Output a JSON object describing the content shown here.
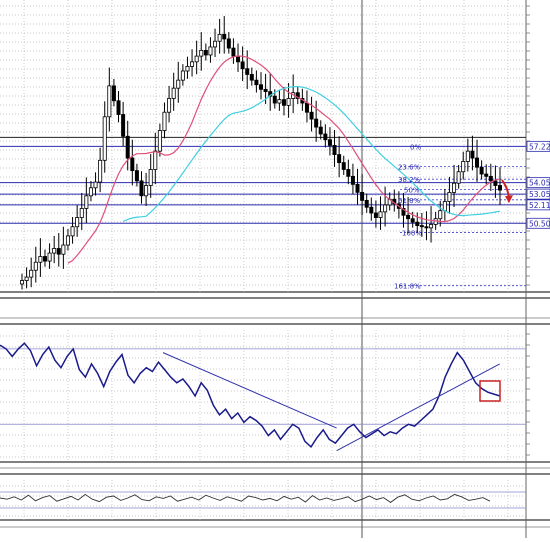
{
  "chart_data": [
    {
      "panel": "price",
      "type": "candlestick",
      "fib_labels": [
        "0%",
        "23.6%",
        "38.2%",
        "50%",
        "61.8%",
        "100%",
        "161.8%"
      ],
      "price_levels": [
        "57.22",
        "54.05",
        "53.05",
        "52.11",
        "50.50"
      ],
      "fib_levels": [
        {
          "label": "0%",
          "y": 57.22
        },
        {
          "label": "23.6%",
          "y": 55.45
        },
        {
          "label": "38.2%",
          "y": 54.35
        },
        {
          "label": "50%",
          "y": 53.45
        },
        {
          "label": "61.8%",
          "y": 52.55
        },
        {
          "label": "100%",
          "y": 49.7
        },
        {
          "label": "161.8%",
          "y": 45.05
        }
      ],
      "horizontal_lines": [
        58.0,
        57.22,
        54.05,
        53.05,
        52.11,
        50.5
      ],
      "price_close": [
        45.5,
        45.8,
        46.4,
        47.1,
        47.6,
        47.2,
        47.9,
        48.3,
        47.8,
        48.6,
        49.4,
        50.2,
        51.0,
        51.8,
        52.9,
        53.6,
        54.1,
        56.0,
        59.8,
        62.5,
        61.2,
        60.0,
        58.1,
        56.2,
        55.1,
        54.2,
        52.9,
        53.8,
        55.2,
        56.8,
        58.6,
        60.2,
        61.4,
        62.3,
        63.0,
        63.8,
        64.2,
        64.6,
        65.1,
        65.6,
        65.2,
        65.9,
        66.4,
        67.0,
        66.6,
        65.8,
        65.1,
        64.6,
        64.0,
        63.5,
        63.0,
        62.6,
        62.2,
        62.0,
        61.6,
        61.0,
        61.3,
        60.8,
        61.4,
        61.9,
        61.4,
        61.0,
        60.2,
        59.6,
        58.9,
        58.3,
        57.8,
        57.3,
        56.5,
        55.8,
        55.2,
        54.6,
        53.9,
        53.2,
        52.5,
        51.9,
        51.4,
        51.0,
        51.5,
        52.1,
        52.6,
        52.2,
        51.8,
        51.2,
        50.9,
        50.6,
        50.3,
        50.2,
        50.1,
        50.4,
        50.9,
        51.6,
        52.4,
        53.2,
        54.0,
        55.0,
        55.9,
        56.8,
        56.2,
        55.4,
        54.8,
        54.6,
        54.2,
        53.8,
        53.4
      ],
      "sma_fast_color": "#e0507a",
      "sma_slow_color": "#40d0e0",
      "up_color": "#000000",
      "down_color": "#000000",
      "signal_arrow_color": "#cc2222",
      "ylim": [
        44.5,
        70.0
      ]
    },
    {
      "panel": "oscillator",
      "type": "line",
      "color": "#1a1a8c",
      "values": [
        72,
        70,
        66,
        70,
        73,
        69,
        61,
        67,
        71,
        64,
        60,
        66,
        70,
        59,
        55,
        62,
        57,
        50,
        58,
        63,
        67,
        56,
        52,
        57,
        60,
        58,
        63,
        59,
        55,
        52,
        54,
        50,
        45,
        52,
        48,
        40,
        35,
        38,
        33,
        36,
        31,
        34,
        32,
        29,
        24,
        27,
        22,
        26,
        30,
        28,
        21,
        18,
        23,
        27,
        22,
        20,
        24,
        28,
        30,
        26,
        23,
        25,
        27,
        24,
        26,
        25,
        28,
        30,
        29,
        32,
        35,
        38,
        45,
        55,
        62,
        68,
        64,
        58,
        52,
        49,
        47,
        46,
        45
      ],
      "trendline_color": "#3333aa",
      "trend_lines": [
        {
          "x": [
            0.31,
            0.64
          ],
          "y": [
            68,
            28
          ]
        },
        {
          "x": [
            0.64,
            0.95
          ],
          "y": [
            16,
            62
          ]
        }
      ],
      "highlight_box_color": "#cc2222",
      "levels": [
        70,
        30
      ],
      "ylim": [
        10,
        80
      ]
    },
    {
      "panel": "momentum",
      "type": "line",
      "color": "#333333",
      "values": [
        55,
        52,
        58,
        50,
        62,
        48,
        56,
        61,
        47,
        53,
        59,
        50,
        64,
        52,
        46,
        57,
        60,
        49,
        55,
        63,
        51,
        48,
        58,
        54,
        60,
        47,
        52,
        57,
        50,
        62,
        55,
        49,
        58,
        53,
        47,
        60,
        56,
        50,
        54,
        48,
        59,
        52,
        57,
        45,
        61,
        50,
        55,
        49,
        53,
        58,
        46,
        52,
        60,
        51,
        56,
        44,
        57,
        63,
        52,
        48,
        55,
        60,
        50,
        53,
        64,
        58,
        49,
        52,
        56,
        47
      ],
      "levels": [
        70,
        30
      ],
      "ylim": [
        0,
        100
      ]
    }
  ]
}
